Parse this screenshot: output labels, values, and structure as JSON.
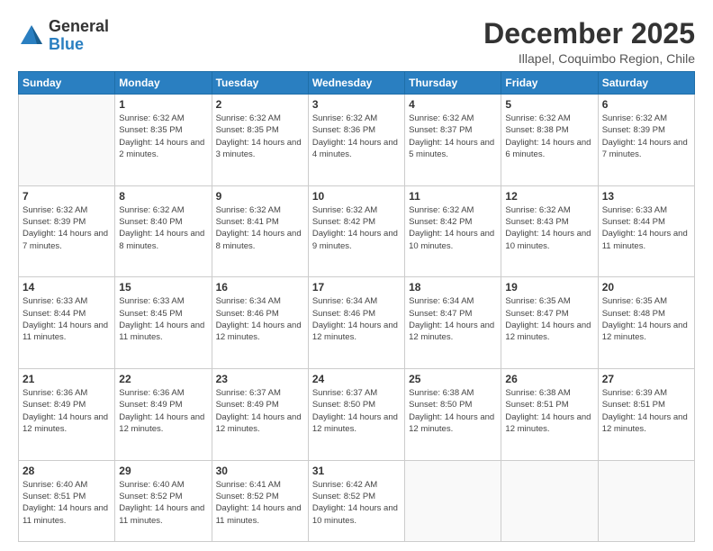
{
  "header": {
    "logo_general": "General",
    "logo_blue": "Blue",
    "month_title": "December 2025",
    "subtitle": "Illapel, Coquimbo Region, Chile"
  },
  "days_of_week": [
    "Sunday",
    "Monday",
    "Tuesday",
    "Wednesday",
    "Thursday",
    "Friday",
    "Saturday"
  ],
  "weeks": [
    [
      {
        "day": "",
        "sunrise": "",
        "sunset": "",
        "daylight": ""
      },
      {
        "day": "1",
        "sunrise": "Sunrise: 6:32 AM",
        "sunset": "Sunset: 8:35 PM",
        "daylight": "Daylight: 14 hours and 2 minutes."
      },
      {
        "day": "2",
        "sunrise": "Sunrise: 6:32 AM",
        "sunset": "Sunset: 8:35 PM",
        "daylight": "Daylight: 14 hours and 3 minutes."
      },
      {
        "day": "3",
        "sunrise": "Sunrise: 6:32 AM",
        "sunset": "Sunset: 8:36 PM",
        "daylight": "Daylight: 14 hours and 4 minutes."
      },
      {
        "day": "4",
        "sunrise": "Sunrise: 6:32 AM",
        "sunset": "Sunset: 8:37 PM",
        "daylight": "Daylight: 14 hours and 5 minutes."
      },
      {
        "day": "5",
        "sunrise": "Sunrise: 6:32 AM",
        "sunset": "Sunset: 8:38 PM",
        "daylight": "Daylight: 14 hours and 6 minutes."
      },
      {
        "day": "6",
        "sunrise": "Sunrise: 6:32 AM",
        "sunset": "Sunset: 8:39 PM",
        "daylight": "Daylight: 14 hours and 7 minutes."
      }
    ],
    [
      {
        "day": "7",
        "sunrise": "Sunrise: 6:32 AM",
        "sunset": "Sunset: 8:39 PM",
        "daylight": "Daylight: 14 hours and 7 minutes."
      },
      {
        "day": "8",
        "sunrise": "Sunrise: 6:32 AM",
        "sunset": "Sunset: 8:40 PM",
        "daylight": "Daylight: 14 hours and 8 minutes."
      },
      {
        "day": "9",
        "sunrise": "Sunrise: 6:32 AM",
        "sunset": "Sunset: 8:41 PM",
        "daylight": "Daylight: 14 hours and 8 minutes."
      },
      {
        "day": "10",
        "sunrise": "Sunrise: 6:32 AM",
        "sunset": "Sunset: 8:42 PM",
        "daylight": "Daylight: 14 hours and 9 minutes."
      },
      {
        "day": "11",
        "sunrise": "Sunrise: 6:32 AM",
        "sunset": "Sunset: 8:42 PM",
        "daylight": "Daylight: 14 hours and 10 minutes."
      },
      {
        "day": "12",
        "sunrise": "Sunrise: 6:32 AM",
        "sunset": "Sunset: 8:43 PM",
        "daylight": "Daylight: 14 hours and 10 minutes."
      },
      {
        "day": "13",
        "sunrise": "Sunrise: 6:33 AM",
        "sunset": "Sunset: 8:44 PM",
        "daylight": "Daylight: 14 hours and 11 minutes."
      }
    ],
    [
      {
        "day": "14",
        "sunrise": "Sunrise: 6:33 AM",
        "sunset": "Sunset: 8:44 PM",
        "daylight": "Daylight: 14 hours and 11 minutes."
      },
      {
        "day": "15",
        "sunrise": "Sunrise: 6:33 AM",
        "sunset": "Sunset: 8:45 PM",
        "daylight": "Daylight: 14 hours and 11 minutes."
      },
      {
        "day": "16",
        "sunrise": "Sunrise: 6:34 AM",
        "sunset": "Sunset: 8:46 PM",
        "daylight": "Daylight: 14 hours and 12 minutes."
      },
      {
        "day": "17",
        "sunrise": "Sunrise: 6:34 AM",
        "sunset": "Sunset: 8:46 PM",
        "daylight": "Daylight: 14 hours and 12 minutes."
      },
      {
        "day": "18",
        "sunrise": "Sunrise: 6:34 AM",
        "sunset": "Sunset: 8:47 PM",
        "daylight": "Daylight: 14 hours and 12 minutes."
      },
      {
        "day": "19",
        "sunrise": "Sunrise: 6:35 AM",
        "sunset": "Sunset: 8:47 PM",
        "daylight": "Daylight: 14 hours and 12 minutes."
      },
      {
        "day": "20",
        "sunrise": "Sunrise: 6:35 AM",
        "sunset": "Sunset: 8:48 PM",
        "daylight": "Daylight: 14 hours and 12 minutes."
      }
    ],
    [
      {
        "day": "21",
        "sunrise": "Sunrise: 6:36 AM",
        "sunset": "Sunset: 8:49 PM",
        "daylight": "Daylight: 14 hours and 12 minutes."
      },
      {
        "day": "22",
        "sunrise": "Sunrise: 6:36 AM",
        "sunset": "Sunset: 8:49 PM",
        "daylight": "Daylight: 14 hours and 12 minutes."
      },
      {
        "day": "23",
        "sunrise": "Sunrise: 6:37 AM",
        "sunset": "Sunset: 8:49 PM",
        "daylight": "Daylight: 14 hours and 12 minutes."
      },
      {
        "day": "24",
        "sunrise": "Sunrise: 6:37 AM",
        "sunset": "Sunset: 8:50 PM",
        "daylight": "Daylight: 14 hours and 12 minutes."
      },
      {
        "day": "25",
        "sunrise": "Sunrise: 6:38 AM",
        "sunset": "Sunset: 8:50 PM",
        "daylight": "Daylight: 14 hours and 12 minutes."
      },
      {
        "day": "26",
        "sunrise": "Sunrise: 6:38 AM",
        "sunset": "Sunset: 8:51 PM",
        "daylight": "Daylight: 14 hours and 12 minutes."
      },
      {
        "day": "27",
        "sunrise": "Sunrise: 6:39 AM",
        "sunset": "Sunset: 8:51 PM",
        "daylight": "Daylight: 14 hours and 12 minutes."
      }
    ],
    [
      {
        "day": "28",
        "sunrise": "Sunrise: 6:40 AM",
        "sunset": "Sunset: 8:51 PM",
        "daylight": "Daylight: 14 hours and 11 minutes."
      },
      {
        "day": "29",
        "sunrise": "Sunrise: 6:40 AM",
        "sunset": "Sunset: 8:52 PM",
        "daylight": "Daylight: 14 hours and 11 minutes."
      },
      {
        "day": "30",
        "sunrise": "Sunrise: 6:41 AM",
        "sunset": "Sunset: 8:52 PM",
        "daylight": "Daylight: 14 hours and 11 minutes."
      },
      {
        "day": "31",
        "sunrise": "Sunrise: 6:42 AM",
        "sunset": "Sunset: 8:52 PM",
        "daylight": "Daylight: 14 hours and 10 minutes."
      },
      {
        "day": "",
        "sunrise": "",
        "sunset": "",
        "daylight": ""
      },
      {
        "day": "",
        "sunrise": "",
        "sunset": "",
        "daylight": ""
      },
      {
        "day": "",
        "sunrise": "",
        "sunset": "",
        "daylight": ""
      }
    ]
  ]
}
